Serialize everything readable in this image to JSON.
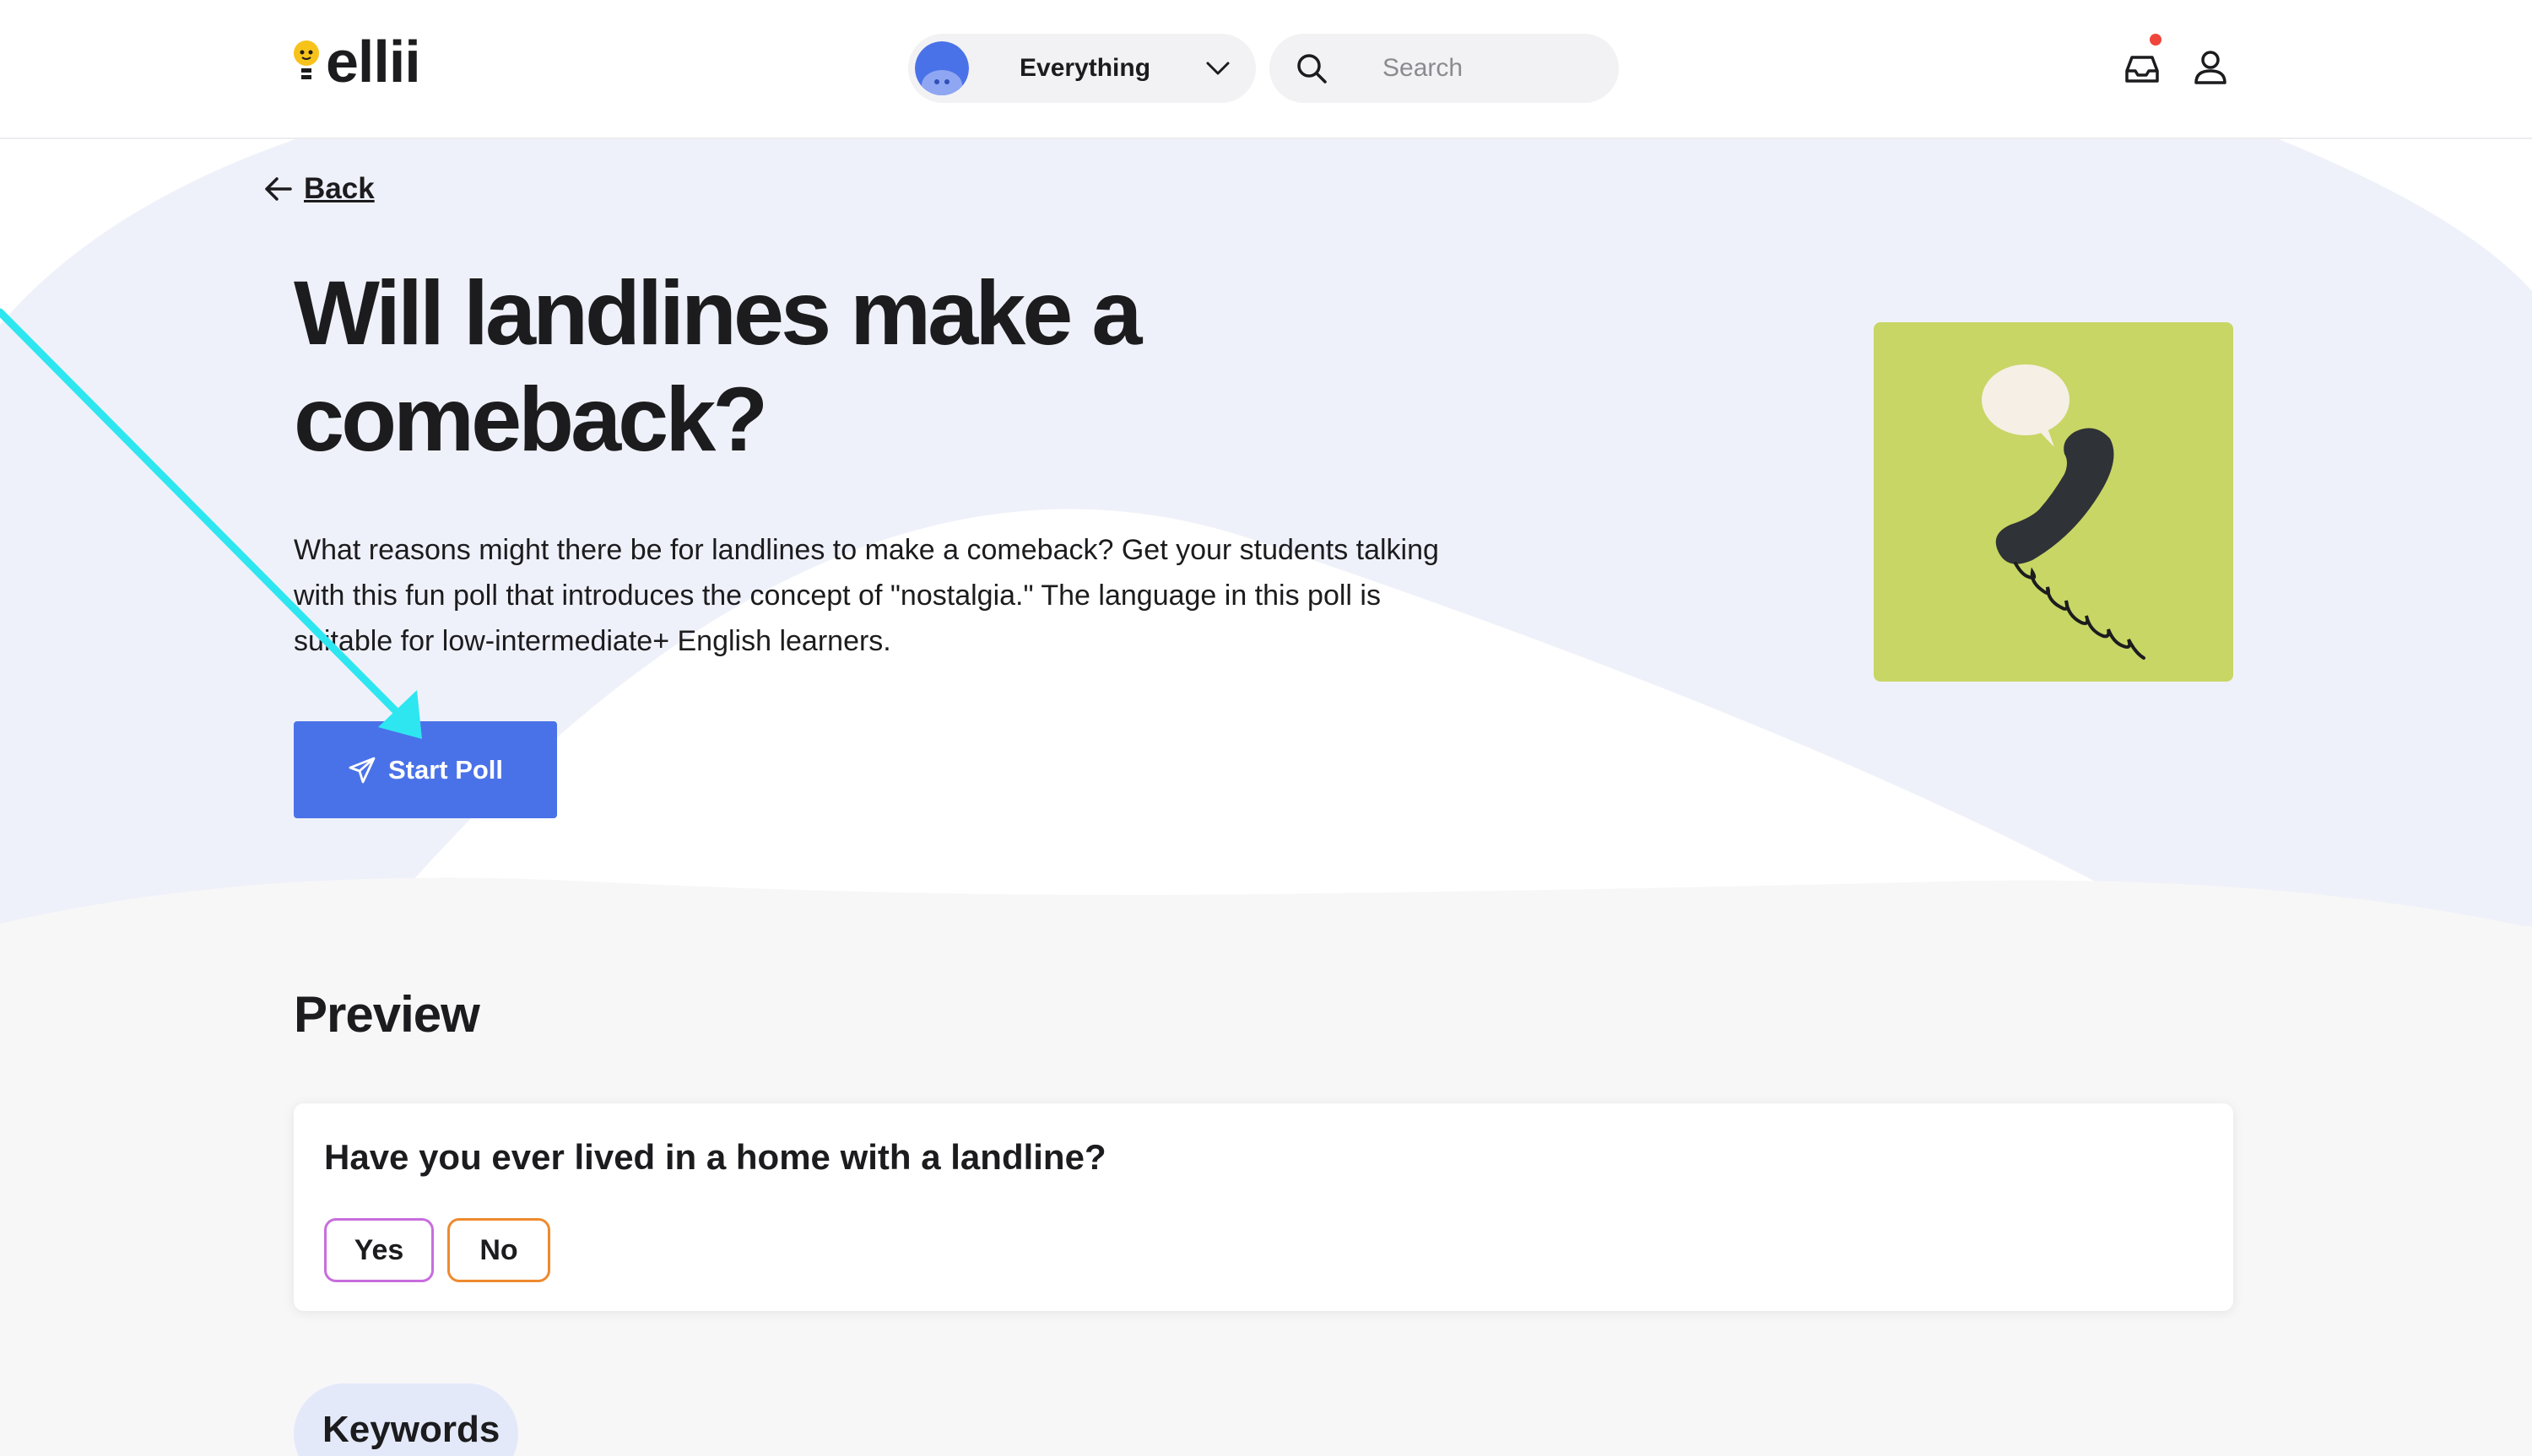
{
  "header": {
    "logo_text": "ellii",
    "scope_label": "Everything",
    "search_placeholder": "Search",
    "has_notification": true
  },
  "hero": {
    "back_label": "Back",
    "title": "Will landlines make a comeback?",
    "description": "What reasons might there be for landlines to make a comeback? Get your students talking with this fun poll that introduces the concept of \"nostalgia.\" The language in this poll is suitable for low-intermediate+ English learners.",
    "start_button_label": "Start Poll",
    "start_button_icon": "paper-plane-icon",
    "thumbnail": "telephone-illustration"
  },
  "preview": {
    "heading": "Preview",
    "question": "Have you ever lived in a home with a landline?",
    "options": [
      "Yes",
      "No"
    ]
  },
  "keywords": {
    "heading": "Keywords"
  },
  "colors": {
    "accent": "#4a72e8",
    "hero_bg": "#eff1fa",
    "thumbnail_bg": "#c8d665",
    "yes_border": "#c86dde",
    "no_border": "#ee8a2e",
    "annotation_arrow": "#2ee6f0"
  }
}
